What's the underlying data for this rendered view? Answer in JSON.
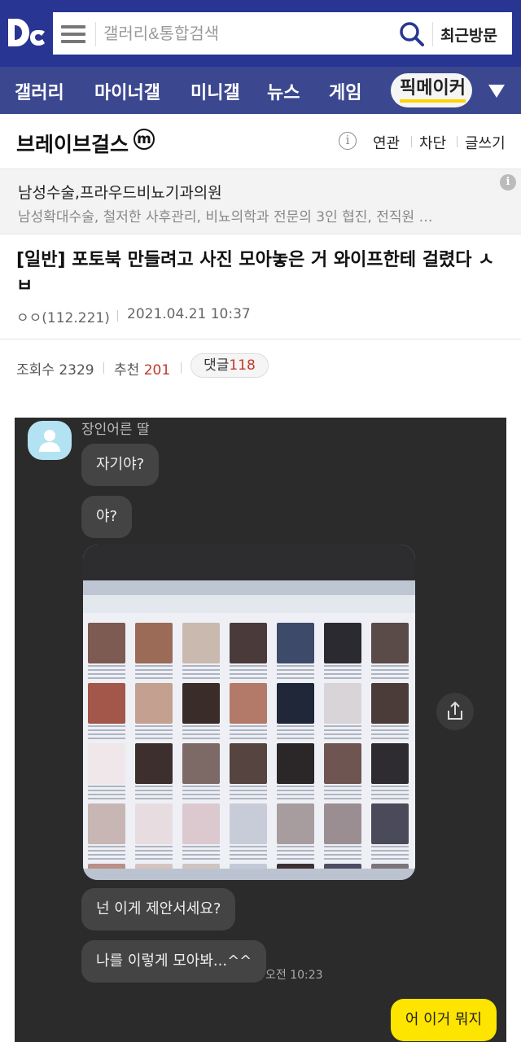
{
  "header": {
    "search_placeholder": "갤러리&통합검색",
    "recent_label": "최근방문"
  },
  "nav": {
    "items": [
      "갤러리",
      "마이너갤",
      "미니갤",
      "뉴스",
      "게임"
    ],
    "active": "픽메이커"
  },
  "gallery": {
    "title": "브레이브걸스",
    "badge": "m",
    "links": [
      "연관",
      "차단",
      "글쓰기"
    ]
  },
  "ad": {
    "title": "남성수술,프라우드비뇨기과의원",
    "description": "남성확대수술, 철저한 사후관리, 비뇨의학과 전문의 3인 협진, 전직원 …"
  },
  "post": {
    "title": "[일반] 포토북 만들려고 사진 모아놓은 거 와이프한테 걸렸다 ㅅㅂ",
    "author": "ㅇㅇ(112.221)",
    "date": "2021.04.21 10:37",
    "views_label": "조회수",
    "views": "2329",
    "recommend_label": "추천",
    "recommend": "201",
    "comments_label": "댓글",
    "comments": "118"
  },
  "chat": {
    "sender": "장인어른 딸",
    "messages": [
      "자기야?",
      "야?",
      "넌 이게 제안서세요?",
      "나를 이렇게 모아봐...^^"
    ],
    "timestamp": "오전 10:23",
    "my_message": "어 이거 뭐지"
  },
  "colors": {
    "header_bg": "#283593",
    "nav_bg": "#3b4890",
    "highlight": "#ffd400",
    "chat_bg": "#2b2b2b",
    "my_bubble": "#fee500"
  }
}
